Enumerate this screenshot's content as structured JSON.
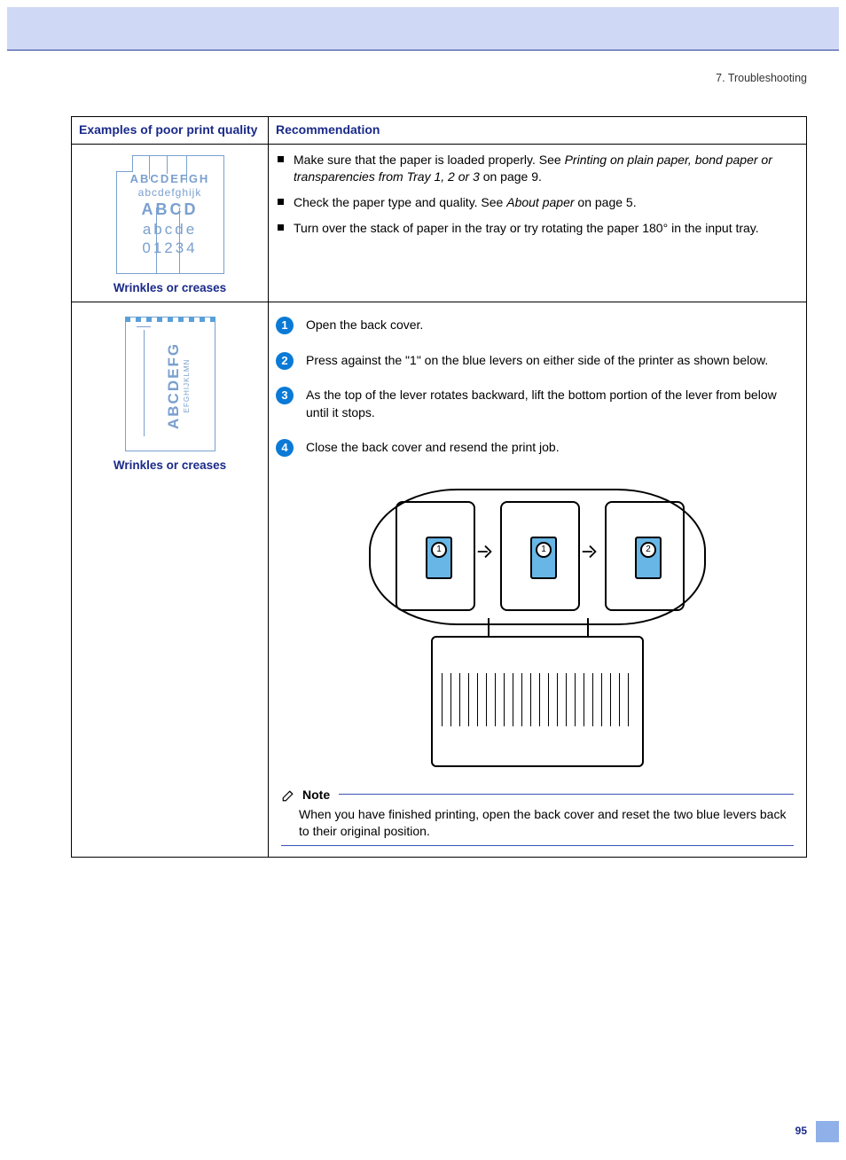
{
  "header": {
    "section": "7. Troubleshooting"
  },
  "table": {
    "col1_header": "Examples of poor print quality",
    "col2_header": "Recommendation"
  },
  "row1": {
    "caption": "Wrinkles or creases",
    "sample": {
      "l1": "ABCDEFGH",
      "l2": "abcdefghijk",
      "l3": "ABCD",
      "l4": "abcde",
      "l5": "01234"
    },
    "bullets": [
      {
        "pre": "Make sure that the paper is loaded properly. See ",
        "link": "Printing on plain paper, bond paper or transparencies from Tray 1, 2 or 3",
        "post": " on page 9."
      },
      {
        "pre": "Check the paper type and quality. See ",
        "link": "About paper",
        "post": " on page 5."
      },
      {
        "pre": "Turn over the stack of paper in the tray or try rotating the paper 180° in the input tray.",
        "link": "",
        "post": ""
      }
    ]
  },
  "row2": {
    "caption": "Wrinkles or creases",
    "sample": {
      "big": "ABCDEFG",
      "small": "EFGHIJKLMN"
    },
    "steps": [
      "Open the back cover.",
      "Press against the \"1\" on the blue levers on either side of the printer as shown below.",
      "As the top of the lever rotates backward, lift the bottom portion of the lever from below until it stops.",
      "Close the back cover and resend the print job."
    ],
    "lever_labels": {
      "a": "1",
      "b": "1",
      "c": "2"
    },
    "note": {
      "label": "Note",
      "body": "When you have finished printing, open the back cover and reset the two blue levers back to their original position."
    }
  },
  "page_number": "95"
}
